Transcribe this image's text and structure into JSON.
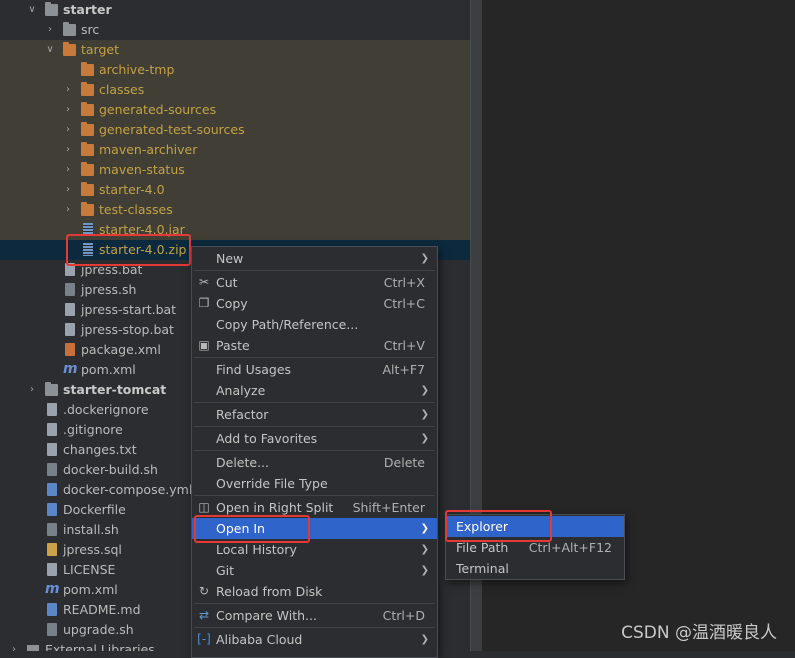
{
  "tree": {
    "starter": "starter",
    "src": "src",
    "target": "target",
    "archive_tmp": "archive-tmp",
    "classes": "classes",
    "generated_sources": "generated-sources",
    "generated_test_sources": "generated-test-sources",
    "maven_archiver": "maven-archiver",
    "maven_status": "maven-status",
    "starter_4_0": "starter-4.0",
    "test_classes": "test-classes",
    "starter_jar": "starter-4.0.jar",
    "starter_zip": "starter-4.0.zip",
    "jpress_bat": "jpress.bat",
    "jpress_sh": "jpress.sh",
    "jpress_start_bat": "jpress-start.bat",
    "jpress_stop_bat": "jpress-stop.bat",
    "package_xml": "package.xml",
    "pom_xml": "pom.xml",
    "starter_tomcat": "starter-tomcat",
    "dockerignore": ".dockerignore",
    "gitignore": ".gitignore",
    "changes_txt": "changes.txt",
    "docker_build_sh": "docker-build.sh",
    "docker_compose_yml": "docker-compose.yml",
    "dockerfile": "Dockerfile",
    "install_sh": "install.sh",
    "jpress_sql": "jpress.sql",
    "license": "LICENSE",
    "root_pom_xml": "pom.xml",
    "readme_md": "README.md",
    "upgrade_sh": "upgrade.sh",
    "external_libraries": "External Libraries"
  },
  "context_menu": {
    "new": "New",
    "cut": "Cut",
    "cut_key": "Ctrl+X",
    "copy": "Copy",
    "copy_key": "Ctrl+C",
    "copy_path": "Copy Path/Reference...",
    "paste": "Paste",
    "paste_key": "Ctrl+V",
    "find_usages": "Find Usages",
    "find_usages_key": "Alt+F7",
    "analyze": "Analyze",
    "refactor": "Refactor",
    "add_favorites": "Add to Favorites",
    "delete": "Delete...",
    "delete_key": "Delete",
    "override_type": "Override File Type",
    "open_right_split": "Open in Right Split",
    "open_right_split_key": "Shift+Enter",
    "open_in": "Open In",
    "local_history": "Local History",
    "git": "Git",
    "reload": "Reload from Disk",
    "compare_with": "Compare With...",
    "compare_with_key": "Ctrl+D",
    "alibaba_cloud": "Alibaba Cloud"
  },
  "submenu": {
    "explorer": "Explorer",
    "file_path": "File Path",
    "file_path_key": "Ctrl+Alt+F12",
    "terminal": "Terminal"
  },
  "watermark": "CSDN @温酒暖良人",
  "colors": {
    "highlight": "#2f65ca",
    "annotation": "#e53935",
    "excluded_text": "#c3a146"
  }
}
